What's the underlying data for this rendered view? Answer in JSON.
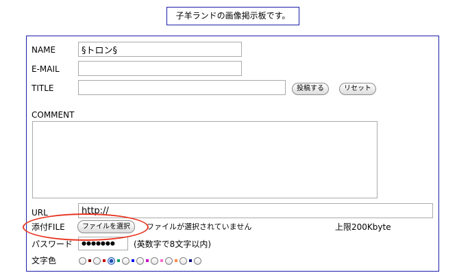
{
  "header": {
    "title": "子羊ランドの画像掲示板です。"
  },
  "form": {
    "name": {
      "label": "NAME",
      "value": "§トロン§"
    },
    "email": {
      "label": "E-MAIL",
      "value": ""
    },
    "title": {
      "label": "TITLE",
      "value": ""
    },
    "submit_label": "投稿する",
    "reset_label": "リセット",
    "comment": {
      "label": "COMMENT",
      "value": ""
    },
    "url": {
      "label": "URL",
      "value": "http://"
    },
    "file": {
      "label": "添付FILE",
      "button_label": "ファイルを選択",
      "status": "ファイルが選択されていません",
      "limit": "上限200Kbyte"
    },
    "password": {
      "label": "パスワード",
      "value": "●●●●●●●",
      "hint": "(英数字で8文字以内)"
    },
    "text_color": {
      "label": "文字色",
      "selected_index": 2,
      "options": [
        "#800000",
        "#cc0000",
        "#009966",
        "#0000ff",
        "#cc00cc",
        "#ff66cc",
        "#ff8844",
        "#000080",
        ""
      ]
    }
  },
  "annotation": {
    "highlight": "file-attach",
    "color": "#e8331f"
  }
}
